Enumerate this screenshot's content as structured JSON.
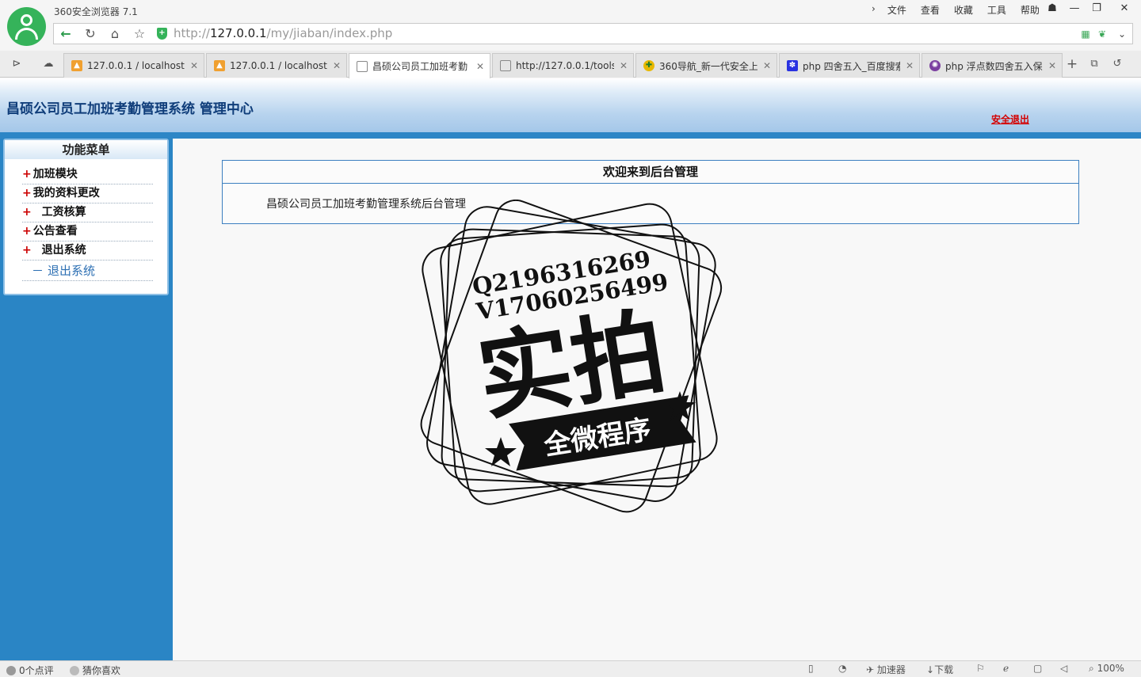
{
  "browser": {
    "app_title": "360安全浏览器 7.1",
    "menu": [
      "文件",
      "查看",
      "收藏",
      "工具",
      "帮助"
    ],
    "url_prefix": "http://",
    "url_host": "127.0.0.1",
    "url_path": "/my/jiaban/index.php",
    "tabs": [
      {
        "label": "127.0.0.1 / localhost",
        "icon": "phpmyadmin-icon"
      },
      {
        "label": "127.0.0.1 / localhost",
        "icon": "phpmyadmin-icon"
      },
      {
        "label": "昌硕公司员工加班考勤",
        "icon": "page-icon",
        "active": true
      },
      {
        "label": "http://127.0.0.1/tools",
        "icon": "page-icon"
      },
      {
        "label": "360导航_新一代安全上",
        "icon": "360-icon"
      },
      {
        "label": "php 四舍五入_百度搜索",
        "icon": "baidu-icon"
      },
      {
        "label": "php 浮点数四舍五入保",
        "icon": "php-icon"
      }
    ],
    "status": {
      "comments": "0个点评",
      "guess": "猜你喜欢",
      "accelerator": "加速器",
      "download": "下载",
      "zoom": "100%"
    }
  },
  "page": {
    "system_title": "昌硕公司员工加班考勤管理系统 管理中心",
    "logout_link": "安全退出",
    "sidebar": {
      "heading": "功能菜单",
      "items": [
        {
          "label": "加班模块",
          "prefix": "+"
        },
        {
          "label": "我的资料更改",
          "prefix": "+"
        },
        {
          "label": "工资核算",
          "prefix": "+ "
        },
        {
          "label": "公告查看",
          "prefix": "+"
        },
        {
          "label": "退出系统",
          "prefix": "+ "
        }
      ],
      "sub_item": {
        "prefix": "－",
        "label": "退出系统"
      }
    },
    "welcome": {
      "heading": "欢迎来到后台管理",
      "body": "昌硕公司员工加班考勤管理系统后台管理"
    }
  },
  "watermark": {
    "line1": "Q2196316269",
    "line2": "V17060256499",
    "big": "实拍",
    "ribbon": "全微程序"
  },
  "colors": {
    "sidebar_blue": "#2a85c5",
    "title_navy": "#0f3d7a",
    "logout_red": "#d40000",
    "accent_green": "#35b35a"
  }
}
